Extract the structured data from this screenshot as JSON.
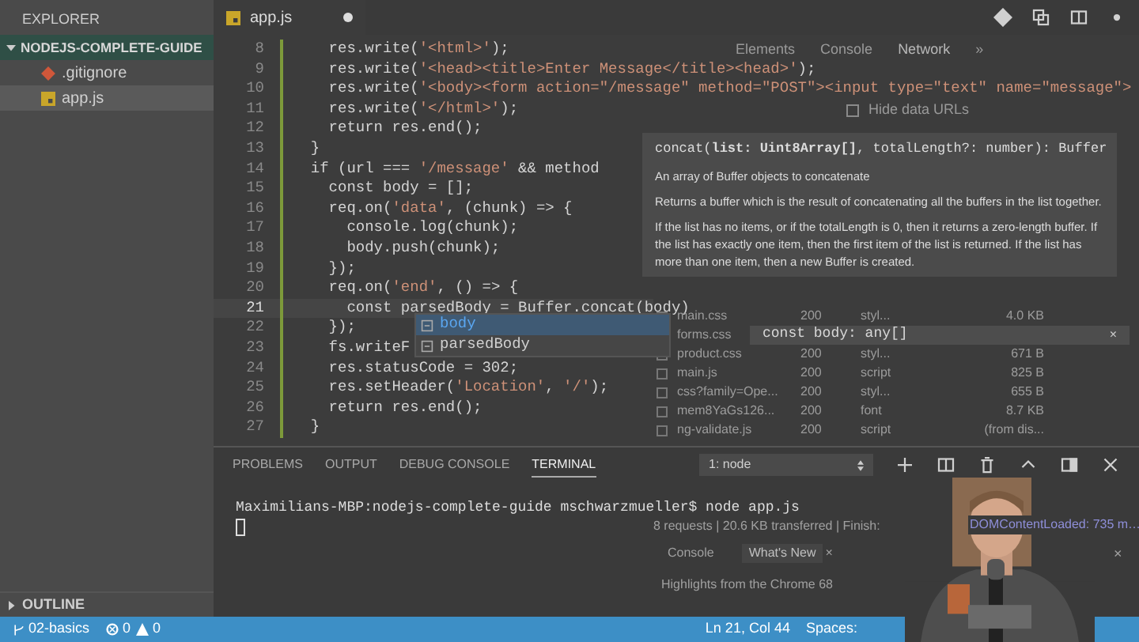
{
  "sidebar": {
    "title": "EXPLORER",
    "folder": {
      "label": "NODEJS-COMPLETE-GUIDE",
      "expanded": true
    },
    "files": [
      {
        "name": ".gitignore",
        "kind": "git",
        "selected": false
      },
      {
        "name": "app.js",
        "kind": "js",
        "selected": true
      }
    ],
    "outline": {
      "label": "OUTLINE",
      "expanded": false
    }
  },
  "editor_tab": {
    "label": "app.js",
    "modified": true
  },
  "code": [
    {
      "n": "8",
      "text": "    res.write('<html>');",
      "current": false
    },
    {
      "n": "9",
      "text": "    res.write('<head><title>Enter Message</title><head>');",
      "current": false
    },
    {
      "n": "10",
      "text": "    res.write('<body><form action=\"/message\" method=\"POST\"><input type=\"text\" name=\"message\">",
      "current": false
    },
    {
      "n": "11",
      "text": "    res.write('</html>');",
      "current": false
    },
    {
      "n": "12",
      "text": "    return res.end();",
      "current": false
    },
    {
      "n": "13",
      "text": "  }",
      "current": false
    },
    {
      "n": "14",
      "text": "  if (url === '/message' && method",
      "current": false
    },
    {
      "n": "15",
      "text": "    const body = [];",
      "current": false
    },
    {
      "n": "16",
      "text": "    req.on('data', (chunk) => {",
      "current": false
    },
    {
      "n": "17",
      "text": "      console.log(chunk);",
      "current": false
    },
    {
      "n": "18",
      "text": "      body.push(chunk);",
      "current": false
    },
    {
      "n": "19",
      "text": "    });",
      "current": false
    },
    {
      "n": "20",
      "text": "    req.on('end', () => {",
      "current": false
    },
    {
      "n": "21",
      "text": "      const parsedBody = Buffer.concat(body)",
      "current": true
    },
    {
      "n": "22",
      "text": "    });",
      "current": false
    },
    {
      "n": "23",
      "text": "    fs.writeF",
      "current": false
    },
    {
      "n": "24",
      "text": "    res.statusCode = 302;",
      "current": false
    },
    {
      "n": "25",
      "text": "    res.setHeader('Location', '/');",
      "current": false
    },
    {
      "n": "26",
      "text": "    return res.end();",
      "current": false
    },
    {
      "n": "27",
      "text": "  }",
      "current": false
    }
  ],
  "signature_help": {
    "signature": "concat(**list: Uint8Array[]**, totalLength?: number): Buffer",
    "paragraphs": [
      "An array of Buffer objects to concatenate",
      "Returns a buffer which is the result of concatenating all the buffers in the list together.",
      "If the list has no items, or if the totalLength is 0, then it returns a zero-length buffer. If the list has exactly one item, then the first item of the list is returned. If the list has more than one item, then a new Buffer is created."
    ]
  },
  "suggestions": [
    {
      "label": "body",
      "selected": true
    },
    {
      "label": "parsedBody",
      "selected": false
    }
  ],
  "hover": {
    "text": "const body: any[]",
    "close": "×"
  },
  "devtools": {
    "tabs": [
      {
        "label": "Elements",
        "selected": false
      },
      {
        "label": "Console",
        "selected": false
      },
      {
        "label": "Network",
        "selected": true
      }
    ],
    "more": "»",
    "hide_data_urls": {
      "label": "Hide data URLs",
      "checked": false
    },
    "rows": [
      {
        "name": "main.css",
        "status": "200",
        "type": "styl...",
        "size": "4.0 KB"
      },
      {
        "name": "forms.css"
      },
      {
        "name": "product.css",
        "status": "200",
        "type": "styl...",
        "size": "671 B"
      },
      {
        "name": "main.js",
        "status": "200",
        "type": "script",
        "size": "825 B"
      },
      {
        "name": "css?family=Ope...",
        "status": "200",
        "type": "styl...",
        "size": "655 B"
      },
      {
        "name": "mem8YaGs126...",
        "status": "200",
        "type": "font",
        "size": "8.7 KB"
      },
      {
        "name": "ng-validate.js",
        "status": "200",
        "type": "script",
        "size": "(from dis..."
      }
    ],
    "summary": "8 requests | 20.6 KB transferred | Finish:",
    "summary_tail": "DOMContentLoaded: 735 m…",
    "drawer_tabs": [
      {
        "label": "Console",
        "selected": false
      },
      {
        "label": "What's New",
        "selected": true
      }
    ],
    "drawer_tab_close": "×",
    "drawer_close": "×",
    "drawer_text": "Highlights from the Chrome 68"
  },
  "panel": {
    "tabs": [
      {
        "label": "PROBLEMS",
        "selected": false
      },
      {
        "label": "OUTPUT",
        "selected": false
      },
      {
        "label": "DEBUG CONSOLE",
        "selected": false
      },
      {
        "label": "TERMINAL",
        "selected": true
      }
    ],
    "terminal_select": "1: node",
    "terminal_lines": [
      "Maximilians-MBP:nodejs-complete-guide mschwarzmueller$ node app.js"
    ]
  },
  "status_bar": {
    "branch": "02-basics",
    "errors": "0",
    "warnings": "0",
    "position": "Ln 21, Col 44",
    "spaces": "Spaces:"
  }
}
